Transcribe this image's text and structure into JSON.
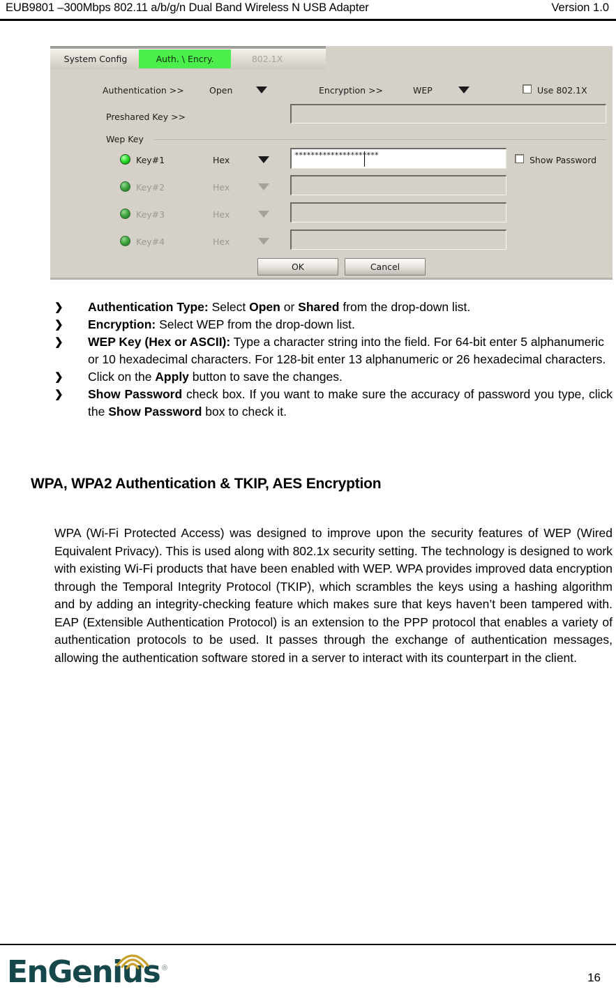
{
  "header": {
    "title": "EUB9801 –300Mbps 802.11 a/b/g/n Dual Band Wireless N USB Adapter",
    "version": "Version 1.0"
  },
  "screenshot": {
    "tabs": [
      {
        "label": "System Config",
        "state": "normal"
      },
      {
        "label": "Auth. \\ Encry.",
        "state": "selected"
      },
      {
        "label": "802.1X",
        "state": "disabled"
      }
    ],
    "fields": {
      "authentication_label": "Authentication >>",
      "authentication_value": "Open",
      "encryption_label": "Encryption >>",
      "encryption_value": "WEP",
      "use_8021x_label": "Use 802.1X",
      "preshared_key_label": "Preshared Key >>",
      "preshared_key_value": ""
    },
    "wep_group_label": "Wep Key",
    "show_password_label": "Show Password",
    "keys": [
      {
        "name": "Key#1",
        "format": "Hex",
        "value": "*********************",
        "enabled": true
      },
      {
        "name": "Key#2",
        "format": "Hex",
        "value": "",
        "enabled": false
      },
      {
        "name": "Key#3",
        "format": "Hex",
        "value": "",
        "enabled": false
      },
      {
        "name": "Key#4",
        "format": "Hex",
        "value": "",
        "enabled": false
      }
    ],
    "buttons": {
      "ok": "OK",
      "cancel": "Cancel"
    },
    "colors": {
      "panel_background": "#d6d1c8",
      "selected_tab": "#4cee4c",
      "led_green": "#38e338"
    }
  },
  "bullets": [
    {
      "marker": "❯",
      "parts": [
        {
          "text": "Authentication Type:",
          "bold": true
        },
        {
          "text": " Select ",
          "bold": false
        },
        {
          "text": "Open",
          "bold": true
        },
        {
          "text": " or ",
          "bold": false
        },
        {
          "text": "Shared",
          "bold": true
        },
        {
          "text": " from the drop-down list.",
          "bold": false
        }
      ]
    },
    {
      "marker": "❯",
      "parts": [
        {
          "text": "Encryption:",
          "bold": true
        },
        {
          "text": " Select WEP from the drop-down list.",
          "bold": false
        }
      ]
    },
    {
      "marker": "❯",
      "parts": [
        {
          "text": "WEP Key (Hex or ASCII):",
          "bold": true
        },
        {
          "text": " Type a character string into the field. For 64-bit enter 5 alphanumeric or 10 hexadecimal characters. For 128-bit enter 13 alphanumeric or 26 hexadecimal characters.",
          "bold": false
        }
      ]
    },
    {
      "marker": "❯",
      "parts": [
        {
          "text": "Click on the ",
          "bold": false
        },
        {
          "text": "Apply",
          "bold": true
        },
        {
          "text": " button to save the changes.",
          "bold": false
        }
      ]
    },
    {
      "marker": "❯",
      "parts": [
        {
          "text": "Show Password",
          "bold": true
        },
        {
          "text": " check box. If you want to make sure the accuracy of password you type, click the ",
          "bold": false
        },
        {
          "text": "Show Password",
          "bold": true
        },
        {
          "text": " box to check it.",
          "bold": false
        }
      ]
    }
  ],
  "section": {
    "heading": "WPA, WPA2 Authentication & TKIP, AES Encryption",
    "paragraph": "WPA (Wi-Fi Protected Access) was designed to improve upon the security features of WEP (Wired Equivalent Privacy).  This is used along with 802.1x security setting. The technology is designed to work with existing Wi-Fi products that have been enabled with WEP.  WPA provides improved data encryption through the Temporal Integrity Protocol (TKIP), which scrambles the keys using a hashing algorithm and by adding an integrity-checking feature which makes sure that keys haven’t been tampered with. EAP (Extensible Authentication Protocol) is an extension to the PPP protocol that enables a variety of authentication protocols to be used. It passes through the exchange of authentication messages, allowing the authentication software stored in a server to interact with its counterpart in the client."
  },
  "footer": {
    "logo_text": "EnGenius",
    "logo_registered": "®",
    "logo_text_color": "#16474a",
    "logo_wave_color": "#c8a02c",
    "page_number": "16"
  }
}
